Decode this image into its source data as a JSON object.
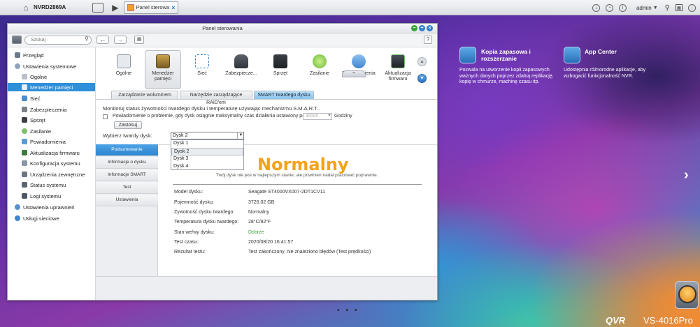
{
  "topbar": {
    "nas_name": "NVRD2869A",
    "task_tab": "Panel sterowa...",
    "user": "admin"
  },
  "desktop": {
    "apps": [
      {
        "title": "Kopia zapasowa i rozszerzanie",
        "desc": "Pozwala na utworzenie kopii zapasowych ważnych danych poprzez zdalną replikację, kopię w chmurze, machinę czasu itp."
      },
      {
        "title": "App Center",
        "desc": "Udostępnia różnorodne aplikacje, aby wzbogacić funkcjonalność NVR."
      }
    ],
    "brand": "QVR",
    "model": "VS-4016Pro"
  },
  "window": {
    "title": "Panel sterowania",
    "search_placeholder": "Szukaj",
    "nav": [
      {
        "label": "Przegląd"
      },
      {
        "label": "Ustawienia systemowe"
      },
      {
        "label": "Ogólne"
      },
      {
        "label": "Menedżer pamięci"
      },
      {
        "label": "Sieć"
      },
      {
        "label": "Zabezpieczenia"
      },
      {
        "label": "Sprzęt"
      },
      {
        "label": "Zasilanie"
      },
      {
        "label": "Powiadomienia"
      },
      {
        "label": "Aktualizacja firmwaru"
      },
      {
        "label": "Konfiguracja systemu"
      },
      {
        "label": "Urządzenia zewnętrzne"
      },
      {
        "label": "Status systemu"
      },
      {
        "label": "Logi systemu"
      },
      {
        "label": "Ustawienia uprawnień"
      },
      {
        "label": "Usługi sieciowe"
      }
    ],
    "categories": [
      {
        "label": "Ogólne"
      },
      {
        "label": "Menedżer pamięci"
      },
      {
        "label": "Sieć"
      },
      {
        "label": "Zabezpiecze..."
      },
      {
        "label": "Sprzęt"
      },
      {
        "label": "Zasilanie"
      },
      {
        "label": "Powiadomienia"
      },
      {
        "label": "Aktualizacja firmwaru"
      }
    ],
    "tabs": [
      {
        "label": "Zarządzanie woluminem"
      },
      {
        "label": "Narzędzie zarządzające RAID'em"
      },
      {
        "label": "SMART twardego dysku"
      }
    ],
    "smart": {
      "intro": "Monitoruj status żywotności twardego dysku i temperaturę używając mechanizmu S.M.A.R.T..",
      "notify_label": "Powiadomienie o problemie, gdy dysk osiągnie maksymalny czas działania ustawiony poniżej:",
      "hours_placeholder": "30000",
      "hours_unit": "Godziny",
      "apply": "Zastosuj",
      "disk_label": "Wybierz twardy dysk:",
      "disk_selected": "Dysk 2",
      "disk_options": [
        "Dysk 1",
        "Dysk 2",
        "Dysk 3",
        "Dysk 4"
      ],
      "subtabs": [
        "Podsumowanie",
        "Informacje o dysku",
        "Informacje SMART",
        "Test",
        "Ustawienia"
      ],
      "status": "Normalny",
      "status_desc": "Twój dysk nie jest w najlepszym stanie, ale powinien nadal pracować poprawnie.",
      "info": [
        {
          "label": "Model dysku:",
          "value": "Seagate ST4000VX007-2DT1CV11"
        },
        {
          "label": "Pojemność dysku:",
          "value": "3726.02 GB"
        },
        {
          "label": "Żywotność dysku twardego:",
          "value": "Normalny"
        },
        {
          "label": "Temperatura dysku twardego:",
          "value": "28°C/82°F"
        },
        {
          "label": "Stan we/wy dysku:",
          "value": "Dobrze"
        },
        {
          "label": "Test czasu:",
          "value": "2020/08/20 16:41:57"
        },
        {
          "label": "Rezultat testu:",
          "value": "Test zakończony, nie znaleziono błędów (Test prędkości)"
        }
      ]
    }
  }
}
